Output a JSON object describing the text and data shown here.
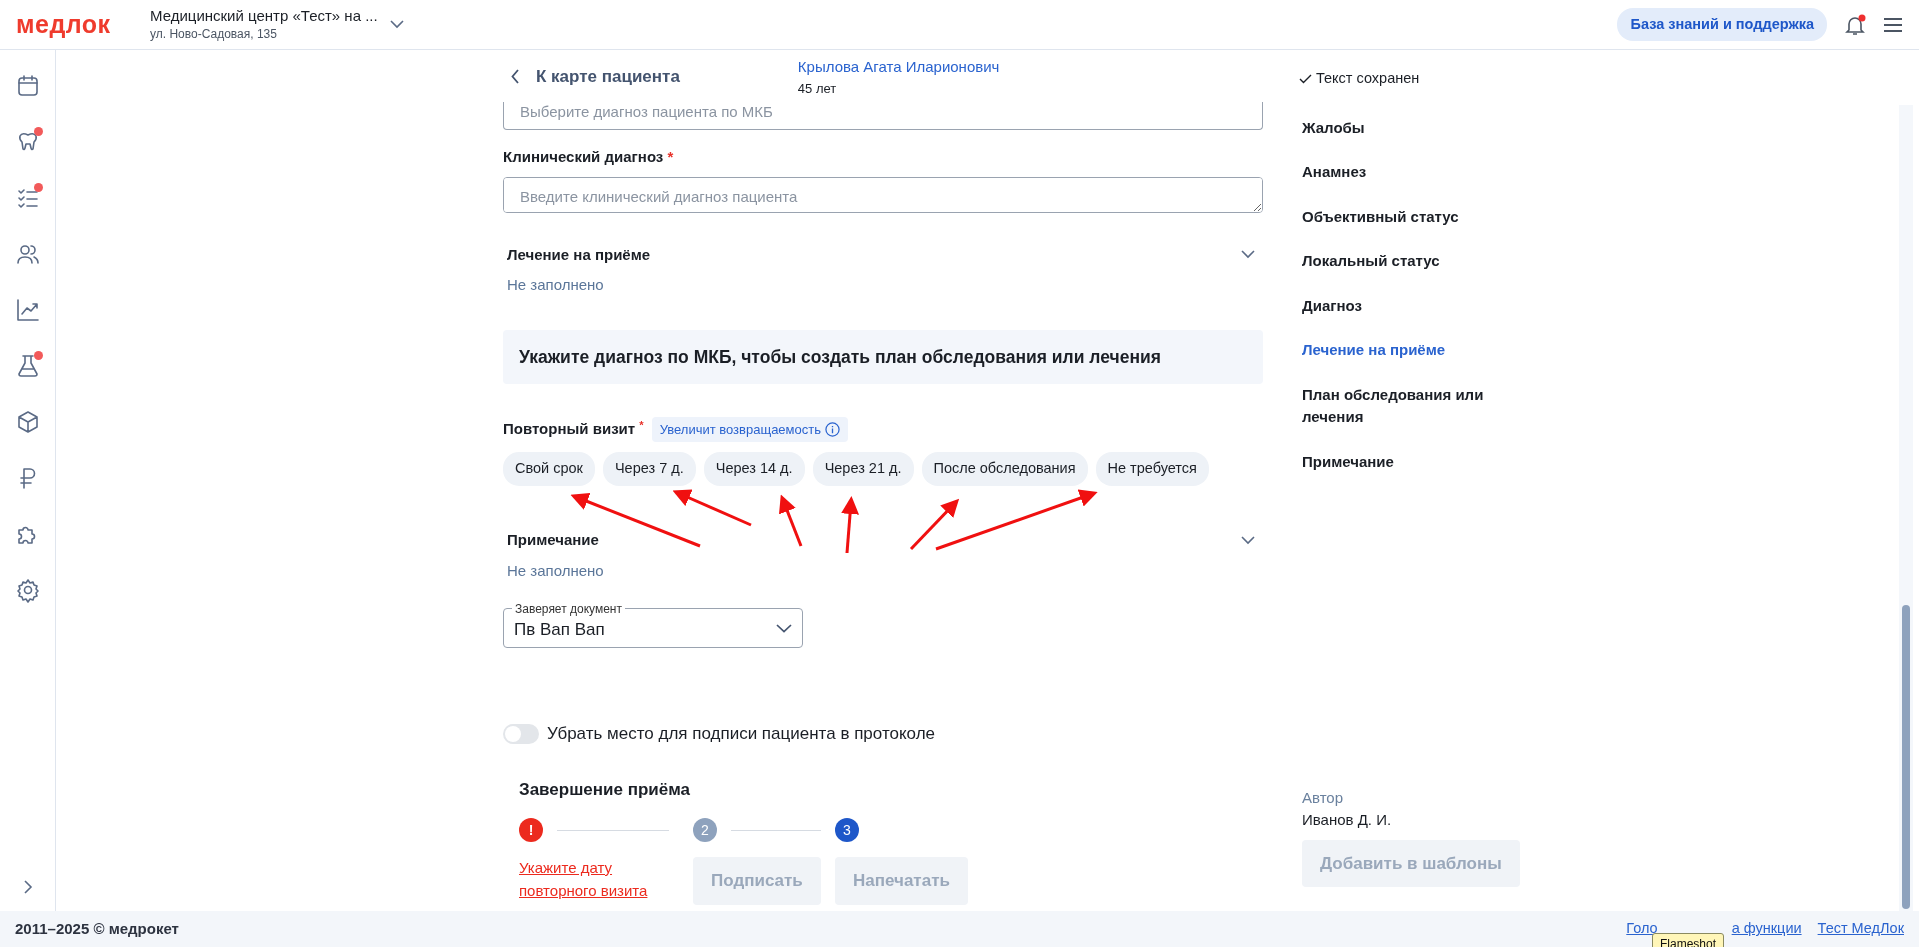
{
  "header": {
    "logo": "медлок",
    "clinic_name": "Медицинский центр «Тест» на ...",
    "clinic_address": "ул. Ново-Садовая, 135",
    "support_button": "База знаний и поддержка",
    "notifications_unread": true
  },
  "sidebar": {
    "items": [
      {
        "kind": "calendar",
        "badge": false
      },
      {
        "kind": "tooth",
        "badge": true
      },
      {
        "kind": "checklist",
        "badge": true
      },
      {
        "kind": "people",
        "badge": false
      },
      {
        "kind": "chart",
        "badge": false
      },
      {
        "kind": "flask",
        "badge": true
      },
      {
        "kind": "box",
        "badge": false
      },
      {
        "kind": "ruble",
        "badge": false
      },
      {
        "kind": "puzzle",
        "badge": false
      },
      {
        "kind": "gear",
        "badge": false
      }
    ]
  },
  "back_link": "К карте пациента",
  "patient": {
    "name": "Крылова Агата Иларионович",
    "age": "45 лет"
  },
  "mkb_field": {
    "placeholder": "Выберите диагноз пациента по МКБ"
  },
  "clinical_diagnosis": {
    "label": "Клинический диагноз",
    "required_mark": "*",
    "placeholder": "Введите клинический диагноз пациента"
  },
  "treatment_section": {
    "title": "Лечение на приёме",
    "value": "Не заполнено"
  },
  "plan_notice": "Укажите диагноз по МКБ, чтобы создать план обследования или лечения",
  "repeat_visit": {
    "label": "Повторный визит",
    "required_mark": "*",
    "hint": "Увеличит возвращаемость",
    "options": [
      {
        "label": "Свой срок",
        "selected": false
      },
      {
        "label": "Через 7 д.",
        "selected": false
      },
      {
        "label": "Через 14 д.",
        "selected": false
      },
      {
        "label": "Через 21 д.",
        "selected": false
      },
      {
        "label": "После обследования",
        "selected": false
      },
      {
        "label": "Не требуется",
        "selected": false
      }
    ]
  },
  "note_section": {
    "title": "Примечание",
    "value": "Не заполнено"
  },
  "certifier_select": {
    "label": "Заверяет документ",
    "value": "Пв Вап Вап"
  },
  "signature_toggle": {
    "label": "Убрать место для подписи пациента в протоколе",
    "on": false
  },
  "completion": {
    "title": "Завершение приёма",
    "steps": [
      {
        "kind": "error",
        "marker": "!",
        "link": "Укажите дату повторного визита"
      },
      {
        "kind": "pending",
        "marker": "2",
        "button": "Подписать",
        "disabled": true
      },
      {
        "kind": "current",
        "marker": "3",
        "button": "Напечатать",
        "disabled": true
      }
    ]
  },
  "save_status": "Текст сохранен",
  "outline": {
    "items": [
      {
        "label": "Жалобы",
        "selected": false
      },
      {
        "label": "Анамнез",
        "selected": false
      },
      {
        "label": "Объективный статус",
        "selected": false
      },
      {
        "label": "Локальный статус",
        "selected": false
      },
      {
        "label": "Диагноз",
        "selected": false
      },
      {
        "label": "Лечение на приёме",
        "selected": true
      },
      {
        "label": "План обследования или лечения",
        "selected": false
      },
      {
        "label": "Примечание",
        "selected": false
      }
    ]
  },
  "author": {
    "label": "Автор",
    "name": "Иванов Д. И."
  },
  "templates_button": {
    "label": "Добавить в шаблоны",
    "disabled": true
  },
  "footer": {
    "copyright": "2011–2025 © медрокет",
    "links": [
      {
        "text": "Голо"
      },
      {
        "text": "а функции"
      },
      {
        "text": "Тест МедЛок"
      }
    ]
  },
  "tooltip": "Flameshot"
}
